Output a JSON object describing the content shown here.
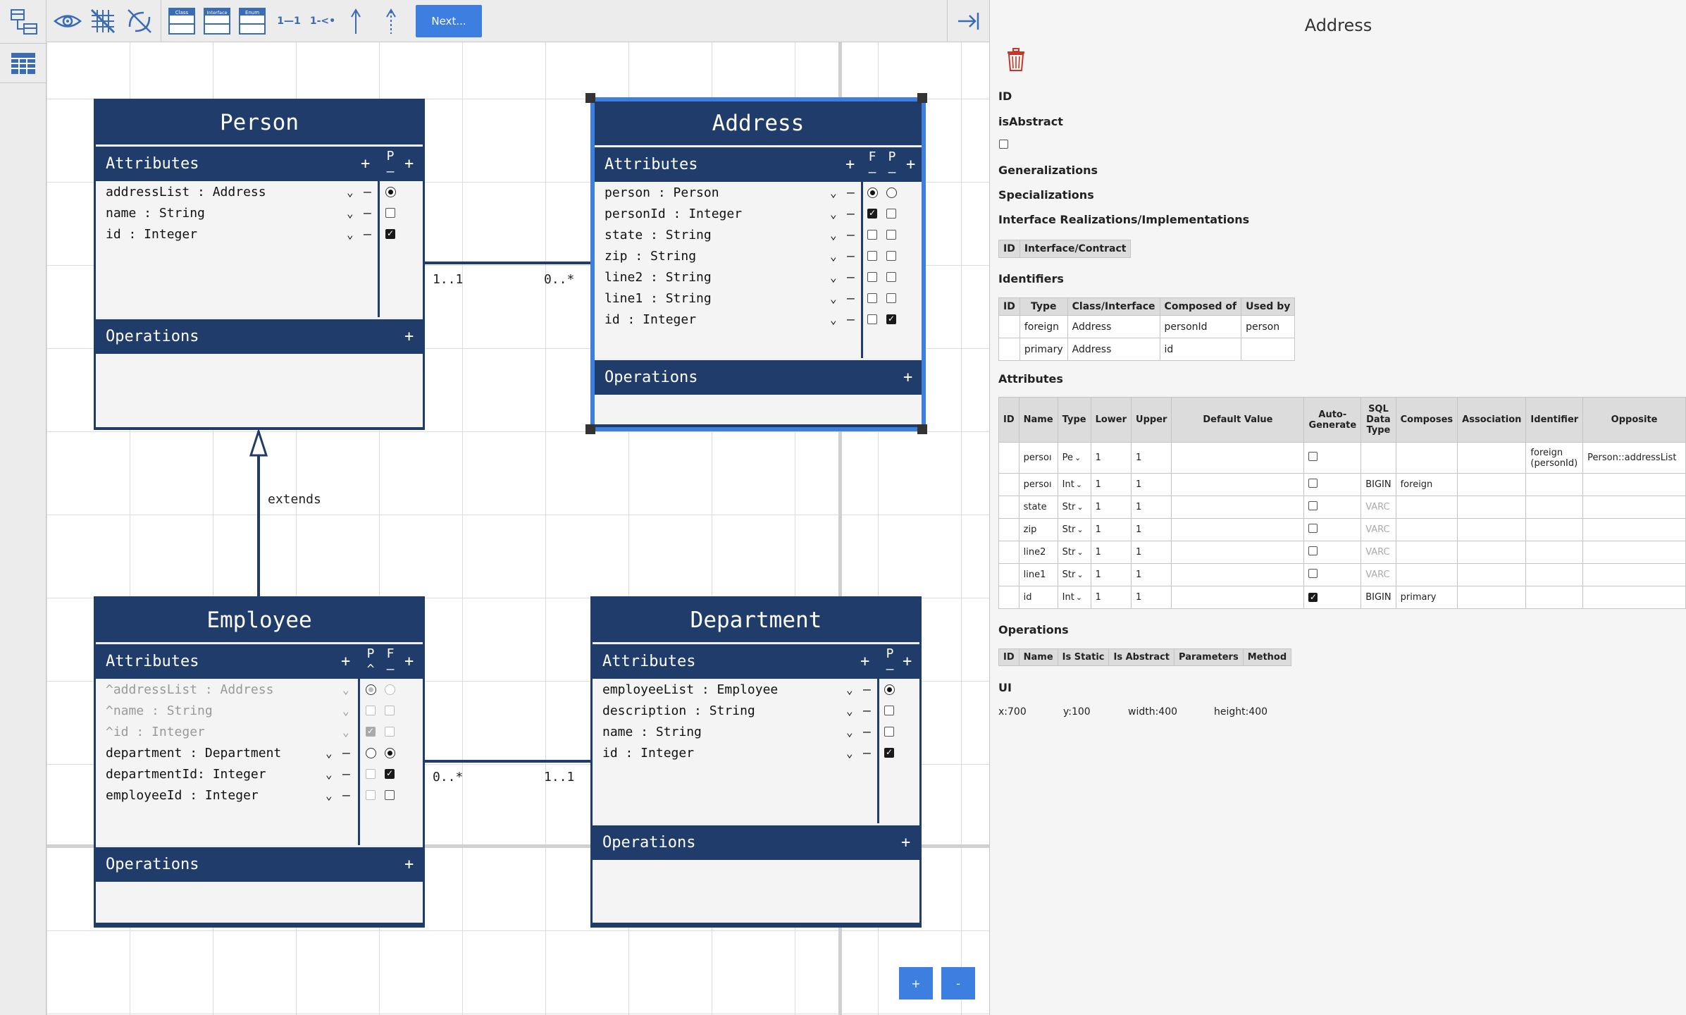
{
  "toolbar": {
    "icons": [
      "show-hide-icon",
      "grid-toggle-icon",
      "no-lines-icon",
      "class-icon",
      "interface-icon",
      "enum-icon",
      "one-to-one-icon",
      "one-to-many-icon",
      "arrow-up-icon",
      "dashed-arrow-up-icon",
      "collapse-panel-icon"
    ],
    "class_label": "Class",
    "interface_label": "Interface",
    "enum_label": "Enum",
    "rel_1_1": "1—1",
    "rel_1_n": "1-<•",
    "next_label": "Next..."
  },
  "diagram": {
    "person": {
      "title": "Person",
      "attributes_label": "Attributes",
      "operations_label": "Operations",
      "col_p": "P",
      "col_p_sub": "–",
      "attrs": [
        {
          "text": "addressList : Address",
          "p": "radio-on"
        },
        {
          "text": "name : String",
          "p": "cb-off"
        },
        {
          "text": "id : Integer",
          "p": "cb-on"
        }
      ]
    },
    "address": {
      "title": "Address",
      "attributes_label": "Attributes",
      "operations_label": "Operations",
      "col_f": "F",
      "col_p": "P",
      "col_sub": "–",
      "attrs": [
        {
          "text": "person : Person"
        },
        {
          "text": "personId : Integer"
        },
        {
          "text": "state : String"
        },
        {
          "text": "zip : String"
        },
        {
          "text": "line2 : String"
        },
        {
          "text": "line1 : String"
        },
        {
          "text": "id : Integer"
        }
      ]
    },
    "employee": {
      "title": "Employee",
      "attributes_label": "Attributes",
      "operations_label": "Operations",
      "col_p": "P",
      "col_p_sub": "^",
      "col_f": "F",
      "col_f_sub": "–",
      "attrs": [
        {
          "text": "^addressList : Address"
        },
        {
          "text": "^name : String"
        },
        {
          "text": "^id : Integer"
        },
        {
          "text": "department : Department"
        },
        {
          "text": "departmentId: Integer"
        },
        {
          "text": "employeeId : Integer"
        }
      ]
    },
    "department": {
      "title": "Department",
      "attributes_label": "Attributes",
      "operations_label": "Operations",
      "col_p": "P",
      "col_p_sub": "–",
      "attrs": [
        {
          "text": "employeeList : Employee"
        },
        {
          "text": "description : String"
        },
        {
          "text": "name : String"
        },
        {
          "text": "id : Integer"
        }
      ]
    },
    "assoc_person_address": {
      "left": "1..1",
      "right": "0..*"
    },
    "assoc_employee_department": {
      "left": "0..*",
      "right": "1..1"
    },
    "extends_label": "extends",
    "zoom_in": "+",
    "zoom_out": "-"
  },
  "panel": {
    "title": "Address",
    "id_label": "ID",
    "is_abstract_label": "isAbstract",
    "generalizations_label": "Generalizations",
    "specializations_label": "Specializations",
    "interfaces_label": "Interface Realizations/Implementations",
    "interfaces_headers": [
      "ID",
      "Interface/Contract"
    ],
    "identifiers_label": "Identifiers",
    "identifiers_headers": [
      "ID",
      "Type",
      "Class/Interface",
      "Composed of",
      "Used by"
    ],
    "identifiers_rows": [
      [
        "",
        "foreign",
        "Address",
        "personId",
        "person"
      ],
      [
        "",
        "primary",
        "Address",
        "id",
        ""
      ]
    ],
    "attributes_label": "Attributes",
    "attr_headers": [
      "ID",
      "Name",
      "Type",
      "Lower",
      "Upper",
      "Default Value",
      "Auto-Generate",
      "SQL Data Type",
      "Composes",
      "Association",
      "Identifier",
      "Opposite"
    ],
    "attr_rows": [
      {
        "name": "persoı",
        "type": "Pe",
        "lower": "1",
        "upper": "1",
        "auto": false,
        "sql": "",
        "composes": "",
        "identifier": "foreign (personId)",
        "opposite": "Person::addressList"
      },
      {
        "name": "persoı",
        "type": "Int",
        "lower": "1",
        "upper": "1",
        "auto": false,
        "sql": "BIGIN",
        "composes": "foreign",
        "identifier": "",
        "opposite": ""
      },
      {
        "name": "state",
        "type": "Str",
        "lower": "1",
        "upper": "1",
        "auto": false,
        "sql": "VARC",
        "composes": "",
        "identifier": "",
        "opposite": ""
      },
      {
        "name": "zip",
        "type": "Str",
        "lower": "1",
        "upper": "1",
        "auto": false,
        "sql": "VARC",
        "composes": "",
        "identifier": "",
        "opposite": ""
      },
      {
        "name": "line2",
        "type": "Str",
        "lower": "1",
        "upper": "1",
        "auto": false,
        "sql": "VARC",
        "composes": "",
        "identifier": "",
        "opposite": ""
      },
      {
        "name": "line1",
        "type": "Str",
        "lower": "1",
        "upper": "1",
        "auto": false,
        "sql": "VARC",
        "composes": "",
        "identifier": "",
        "opposite": ""
      },
      {
        "name": "id",
        "type": "Int",
        "lower": "1",
        "upper": "1",
        "auto": true,
        "sql": "BIGIN",
        "composes": "primary",
        "identifier": "",
        "opposite": ""
      }
    ],
    "operations_label": "Operations",
    "operations_headers": [
      "ID",
      "Name",
      "Is Static",
      "Is Abstract",
      "Parameters",
      "Method"
    ],
    "ui_label": "UI",
    "ui": {
      "x": "x:700",
      "y": "y:100",
      "width": "width:400",
      "height": "height:400"
    }
  }
}
